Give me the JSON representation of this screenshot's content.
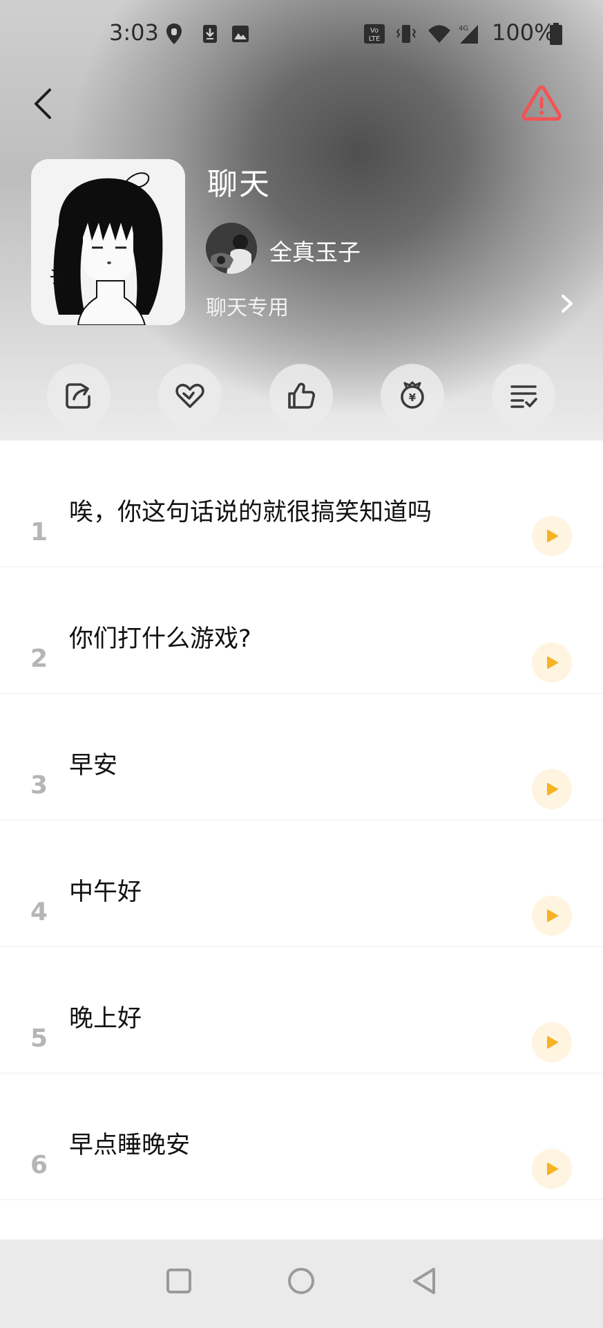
{
  "status_bar": {
    "time": "3:03",
    "battery": "100%",
    "icons": [
      "location-icon",
      "download-icon",
      "image-icon",
      "volte-icon",
      "vibrate-icon",
      "wifi-icon",
      "signal-4g-icon",
      "battery-icon"
    ]
  },
  "header": {
    "back_icon": "chevron-left-icon",
    "report_icon": "warning-triangle-icon",
    "report_color": "#f05454"
  },
  "playlist": {
    "title": "聊天",
    "creator": "全真玉子",
    "description": "聊天专用"
  },
  "actions": [
    {
      "name": "share-icon"
    },
    {
      "name": "favorite-icon"
    },
    {
      "name": "like-icon"
    },
    {
      "name": "reward-icon"
    },
    {
      "name": "playlist-icon"
    }
  ],
  "tracks": [
    {
      "number": "1",
      "title": "唉，你这句话说的就很搞笑知道吗"
    },
    {
      "number": "2",
      "title": "你们打什么游戏?"
    },
    {
      "number": "3",
      "title": "早安"
    },
    {
      "number": "4",
      "title": "中午好"
    },
    {
      "number": "5",
      "title": "晚上好"
    },
    {
      "number": "6",
      "title": "早点睡晚安"
    }
  ],
  "colors": {
    "play_accent": "#f5b325",
    "play_bg": "#fff4e0"
  },
  "navbar": {
    "icons": [
      "recents-square-icon",
      "home-circle-icon",
      "back-triangle-icon"
    ]
  }
}
